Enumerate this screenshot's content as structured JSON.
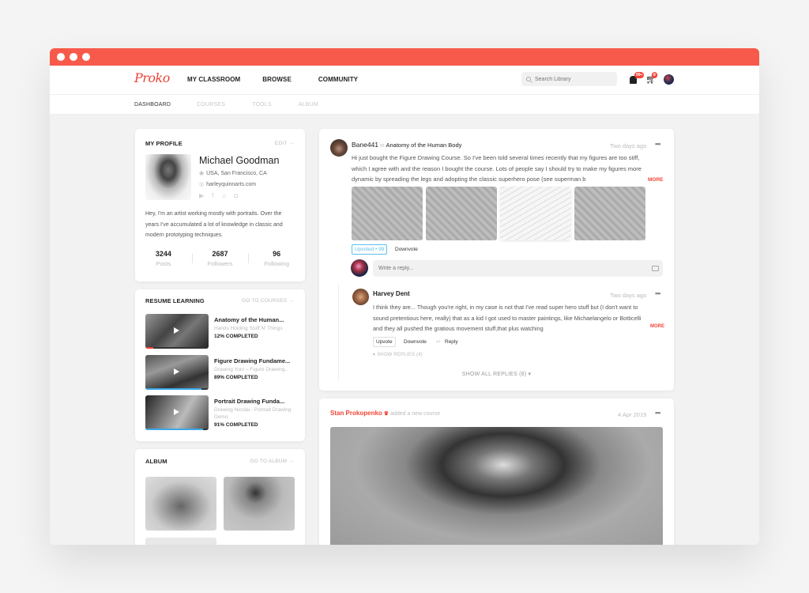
{
  "window": {
    "controls": [
      "close",
      "minimize",
      "maximize"
    ]
  },
  "nav": {
    "logo": "Proko",
    "items": [
      "MY CLASSROOM",
      "BROWSE",
      "COMMUNITY"
    ],
    "search_placeholder": "Search Library",
    "notifications_badge": "99+",
    "cart_badge": "8"
  },
  "subnav": {
    "items": [
      "DASHBOARD",
      "COURSES",
      "TOOLS",
      "ALBUM"
    ],
    "active": "DASHBOARD"
  },
  "profile": {
    "title": "MY PROFILE",
    "edit": "EDIT →",
    "name": "Michael Goodman",
    "location": "USA, San Francisco, CA",
    "website": "harleyquinnarts.com",
    "social": [
      "youtube",
      "facebook",
      "twitter",
      "instagram"
    ],
    "bio": "Hey, I'm an artist working mostly with portraits. Over the years I've accumulated a lot of knowledge in classic and modern prototyping techniques.",
    "stats": [
      {
        "value": "3244",
        "label": "Posts"
      },
      {
        "value": "2687",
        "label": "Followers"
      },
      {
        "value": "96",
        "label": "Following"
      }
    ]
  },
  "resume": {
    "title": "RESUME LEARNING",
    "link": "GO TO COURSES →",
    "courses": [
      {
        "title": "Anatomy of the Human...",
        "subtitle": "Hands Holding Stuff N' Things",
        "progress_label": "12% COMPLETED",
        "progress": 12,
        "bar_color": "#f44336"
      },
      {
        "title": "Figure Drawing Fundame...",
        "subtitle": "Drawing Yoni – Figure Drawing...",
        "progress_label": "89% COMPLETED",
        "progress": 89,
        "bar_color": "#3aa8e8"
      },
      {
        "title": "Portrait Drawing Funda...",
        "subtitle": "Drawing Nicolai - Portrait Drawing Demo",
        "progress_label": "91% COMPLETED",
        "progress": 91,
        "bar_color": "#3aa8e8"
      }
    ]
  },
  "album": {
    "title": "ALBUM",
    "link": "GO TO ALBUM →"
  },
  "post": {
    "author": "Bane441",
    "in": "in",
    "course": "Anatomy of the Human Body",
    "time": "Two days ago",
    "text": "Hi just bought the Figure Drawing Course. So I've been told several times recently that my figures are too stiff, which I agree with and the reason I bought the course. Lots of people say I should try to make my figures more dynamic by spreading the legs and adopting the classic superhero pose (see superman b",
    "more": "MORE",
    "upvote": "Upvoted • 99",
    "downvote": "Downvote",
    "reply_placeholder": "Write a reply...",
    "comment": {
      "author": "Harvey Dent",
      "time": "Two days ago",
      "text": "I think they are... Though you're right, in my case is not that I've read super hero stuff but (I don't want to sound pretentious here, really) that as a kid I got used to master paintings, like Michaelangelo or Botticelli and they all pushed the gratious movement stuff,that plus watching",
      "more": "MORE",
      "upvote": "Upvote",
      "downvote": "Downvote",
      "reply": "Reply",
      "show_replies": "▾  SHOW REPLIES (4)"
    },
    "show_all": "SHOW ALL REPLIES (8)  ▾"
  },
  "post2": {
    "author": "Stan Prokopenko",
    "action": "added a new course",
    "time": "4 Apr 2019"
  }
}
